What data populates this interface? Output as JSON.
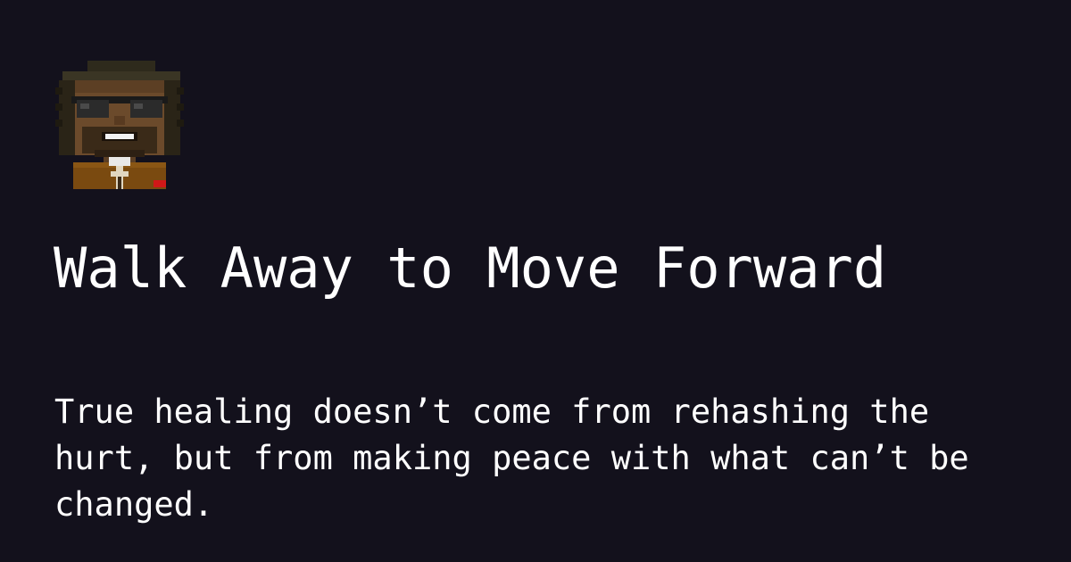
{
  "post": {
    "title": "Walk Away to Move Forward",
    "description": "True healing doesn’t come from rehashing the hurt, but from making peace with what can’t be changed."
  },
  "avatar": {
    "icon": "pixel-art-avatar-icon"
  },
  "colors": {
    "background": "#13111c",
    "text": "#ffffff"
  }
}
